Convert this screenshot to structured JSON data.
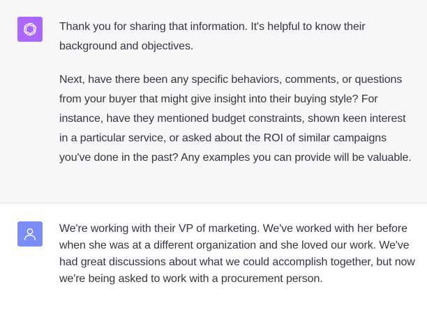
{
  "conversation": {
    "assistant": {
      "avatar_icon": "openai-logo-icon",
      "avatar_color": "#ab68ff",
      "paragraphs": [
        "Thank you for sharing that information. It's helpful to know their background and objectives.",
        "Next, have there been any specific behaviors, comments, or questions from your buyer that might give insight into their buying style? For instance, have they mentioned budget constraints, shown keen interest in a particular service, or asked about the ROI of similar campaigns you've done in the past? Any examples you can provide will be valuable."
      ]
    },
    "user": {
      "avatar_icon": "user-icon",
      "avatar_color": "#7a8cf5",
      "text": "We're working with their VP of marketing. We've worked with her before when she was at a different organization and she loved our work. We've had great discussions about what we could accomplish together, but now we're being asked to work with a procurement person."
    }
  }
}
